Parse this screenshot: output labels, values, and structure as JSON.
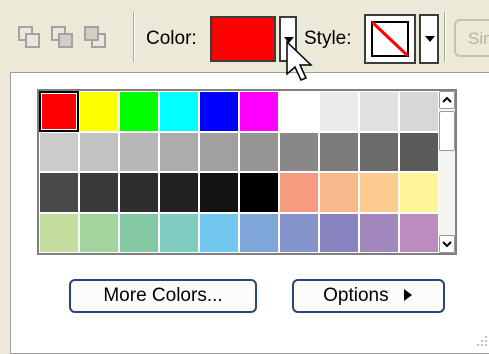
{
  "toolbar": {
    "color_label": "Color:",
    "style_label": "Style:",
    "selected_color": "#ff0000",
    "sin_label": "Sin",
    "icons": [
      "send-backward-icon",
      "group-icon",
      "bring-forward-icon"
    ]
  },
  "palette": {
    "rows": [
      [
        "#ff0000",
        "#ffff00",
        "#00ff00",
        "#00ffff",
        "#0000ff",
        "#ff00ff",
        "#ffffff",
        "#ebebeb",
        "#e1e1e1",
        "#d7d7d7"
      ],
      [
        "#cccccc",
        "#c2c2c2",
        "#b7b7b7",
        "#acacac",
        "#a0a0a0",
        "#959595",
        "#888888",
        "#7b7b7b",
        "#6b6b6b",
        "#5a5a5a"
      ],
      [
        "#494949",
        "#3a3a3a",
        "#2e2e2e",
        "#222222",
        "#141414",
        "#000000",
        "#f59b7f",
        "#f9b88c",
        "#fdca8f",
        "#fef497"
      ],
      [
        "#c3de9c",
        "#a3d49d",
        "#82c9a3",
        "#7fcdc1",
        "#72c7ee",
        "#7ea7d8",
        "#8493ca",
        "#8882be",
        "#a287bd",
        "#bc8cbf"
      ]
    ]
  },
  "buttons": {
    "more_colors": "More Colors...",
    "options": "Options"
  }
}
